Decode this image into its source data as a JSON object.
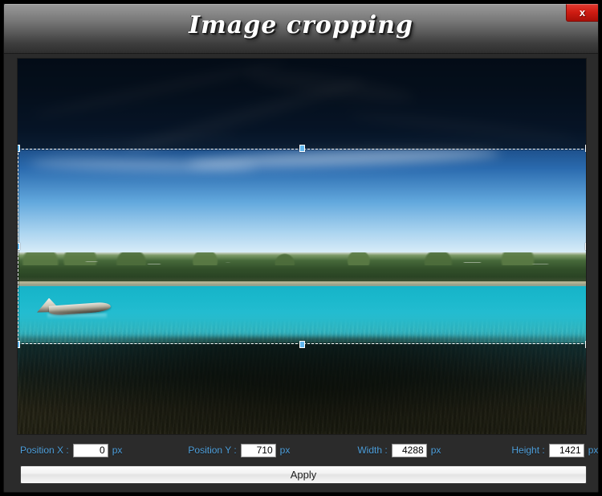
{
  "window": {
    "title": "Image cropping",
    "close_label": "x",
    "close_icon": "close-icon"
  },
  "image": {
    "alt": "Turquoise lake with wooded shoreline, small boat and deep blue sky",
    "crop_overlay_note": "dashed selection band across the middle of the photo"
  },
  "fields": [
    {
      "label": "Position X :",
      "value": "0",
      "unit": "px",
      "name": "position-x"
    },
    {
      "label": "Position Y :",
      "value": "710",
      "unit": "px",
      "name": "position-y"
    },
    {
      "label": "Width :",
      "value": "4288",
      "unit": "px",
      "name": "width"
    },
    {
      "label": "Height :",
      "value": "1421",
      "unit": "px",
      "name": "height"
    }
  ],
  "actions": {
    "apply_label": "Apply"
  },
  "colors": {
    "label_blue": "#4e9fdb",
    "close_red": "#cf1c12",
    "handle_blue": "#62b8ef",
    "window_bg": "#2b2b2b"
  }
}
